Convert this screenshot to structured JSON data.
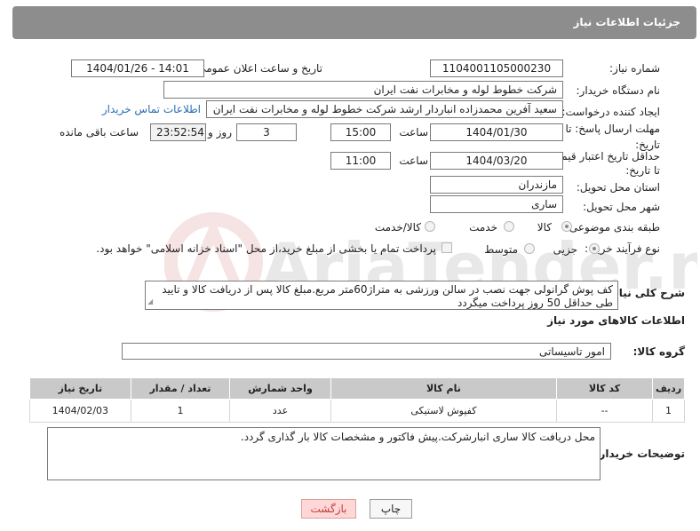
{
  "header": {
    "title": "جزئیات اطلاعات نیاز"
  },
  "form": {
    "need_number_label": "شماره نیاز:",
    "need_number": "1104001105000230",
    "announce_label": "تاریخ و ساعت اعلان عمومی:",
    "announce_value": "1404/01/26 - 14:01",
    "buyer_org_label": "نام دستگاه خریدار:",
    "buyer_org": "شرکت خطوط لوله و مخابرات نفت ایران",
    "requester_label": "ایجاد کننده درخواست:",
    "requester": "سعید آفرین محمدزاده انباردار ارشد شرکت خطوط لوله و مخابرات نفت ایران",
    "contact_link": "اطلاعات تماس خریدار",
    "deadline_label": "مهلت ارسال پاسخ: تا تاریخ:",
    "deadline_date": "1404/01/30",
    "time_word": "ساعت",
    "deadline_time": "15:00",
    "days_count": "3",
    "days_and": "روز و",
    "remaining_time": "23:52:54",
    "remaining_label": "ساعت باقی مانده",
    "price_validity_label": "حداقل تاریخ اعتبار قیمت: تا تاریخ:",
    "price_validity_date": "1404/03/20",
    "price_validity_time": "11:00",
    "province_label": "استان محل تحویل:",
    "province": "مازندران",
    "city_label": "شهر محل تحویل:",
    "city": "ساری",
    "category_label": "طبقه بندی موضوعی:",
    "category_options": [
      "کالا",
      "خدمت",
      "کالا/خدمت"
    ],
    "process_label": "نوع فرآیند خرید :",
    "process_options": [
      "جزیی",
      "متوسط"
    ],
    "payment_note": "پرداخت تمام یا بخشی از مبلغ خرید،از محل \"اسناد خزانه اسلامی\" خواهد بود."
  },
  "description": {
    "label": "شرح کلی نیاز:",
    "text": "کف پوش گرانولی جهت نصب در سالن ورزشی به متراژ60متر مربع.مبلغ کالا پس از دریافت کالا و تایید طی حداقل 50 روز پرداخت میگردد"
  },
  "goods": {
    "section_title": "اطلاعات کالاهای مورد نیاز",
    "group_label": "گروه کالا:",
    "group_value": "امور تاسیساتی",
    "columns": [
      "ردیف",
      "کد کالا",
      "نام کالا",
      "واحد شمارش",
      "تعداد / مقدار",
      "تاریخ نیاز"
    ],
    "rows": [
      [
        "1",
        "--",
        "کفپوش لاستیکی",
        "عدد",
        "1",
        "1404/02/03"
      ]
    ]
  },
  "buyer_notes": {
    "label": "توضیحات خریدار:",
    "text": "محل دریافت کالا ساری انبارشرکت.پیش فاکتور و مشخصات کالا بار گذاری گردد."
  },
  "buttons": {
    "print": "چاپ",
    "back": "بازگشت"
  },
  "colors": {
    "header": "#8d8d8d",
    "link": "#2a6db2",
    "back_button": "#ffd7d7"
  },
  "watermark_text": "AriaTender.neT"
}
